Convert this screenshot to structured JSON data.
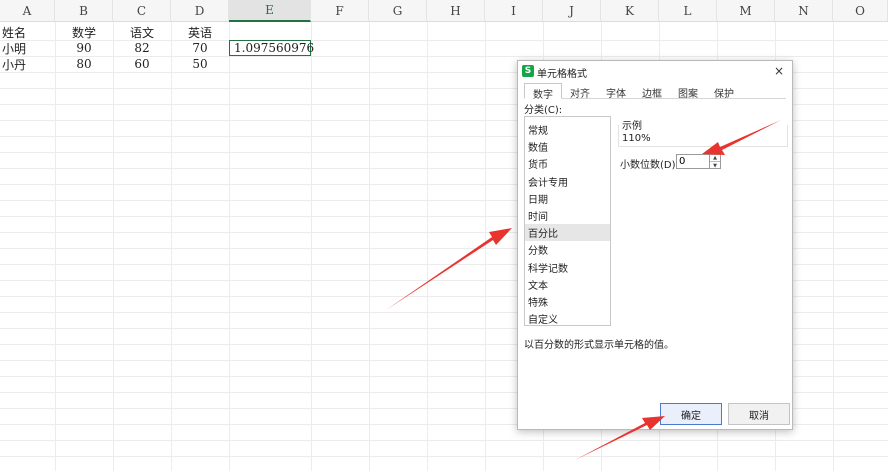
{
  "sheet": {
    "columns": [
      "A",
      "B",
      "C",
      "D",
      "E",
      "F",
      "G",
      "H",
      "I",
      "J",
      "K",
      "L",
      "M",
      "N",
      "O"
    ],
    "active_column": "E",
    "rows": [
      [
        "姓名",
        "数学",
        "语文",
        "英语",
        ""
      ],
      [
        "小明",
        "90",
        "82",
        "70",
        "1.097560976"
      ],
      [
        "小丹",
        "80",
        "60",
        "50",
        ""
      ]
    ],
    "selected_cell_value": "1.097560976"
  },
  "dialog": {
    "title": "单元格格式",
    "close_glyph": "×",
    "tabs": [
      "数字",
      "对齐",
      "字体",
      "边框",
      "图案",
      "保护"
    ],
    "active_tab": "数字",
    "category_label": "分类(C):",
    "categories": [
      "常规",
      "数值",
      "货币",
      "会计专用",
      "日期",
      "时间",
      "百分比",
      "分数",
      "科学记数",
      "文本",
      "特殊",
      "自定义"
    ],
    "selected_category": "百分比",
    "sample_label": "示例",
    "sample_value": "110%",
    "decimal_label": "小数位数(D):",
    "decimal_value": "0",
    "description": "以百分数的形式显示单元格的值。",
    "ok_label": "确定",
    "cancel_label": "取消"
  },
  "colors": {
    "accent_green": "#217346",
    "arrow_red": "#e8342f",
    "ok_border": "#4a7bd0"
  }
}
